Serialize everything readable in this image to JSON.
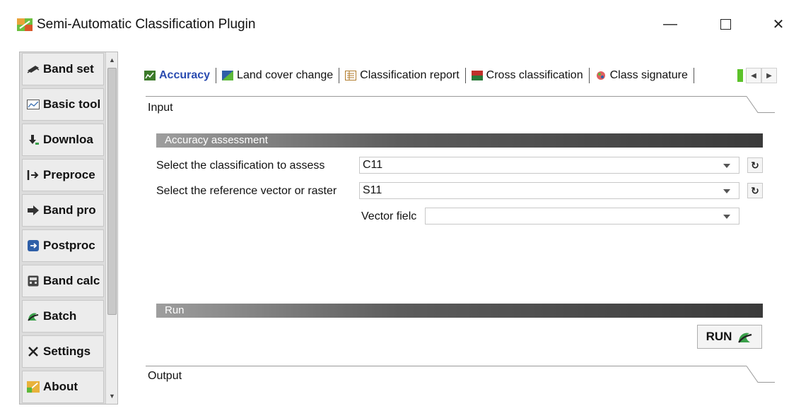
{
  "window": {
    "title": "Semi-Automatic Classification Plugin",
    "minimize_glyph": "—",
    "close_glyph": "✕"
  },
  "sidebar": {
    "items": [
      {
        "label": "Band set",
        "icon": "band-set-icon"
      },
      {
        "label": "Basic tool",
        "icon": "chart-icon"
      },
      {
        "label": "Downloa",
        "icon": "download-icon"
      },
      {
        "label": "Preproce",
        "icon": "preprocessing-icon"
      },
      {
        "label": "Band pro",
        "icon": "band-processing-icon"
      },
      {
        "label": "Postproc",
        "icon": "postprocessing-icon"
      },
      {
        "label": "Band calc",
        "icon": "calculator-icon"
      },
      {
        "label": "Batch",
        "icon": "batch-icon"
      },
      {
        "label": "Settings",
        "icon": "settings-icon"
      },
      {
        "label": "About",
        "icon": "about-icon"
      }
    ]
  },
  "tabs": [
    {
      "label": "Accuracy",
      "active": true
    },
    {
      "label": "Land cover change",
      "active": false
    },
    {
      "label": "Classification report",
      "active": false
    },
    {
      "label": "Cross classification",
      "active": false
    },
    {
      "label": "Class signature",
      "active": false
    }
  ],
  "groups": {
    "input_label": "Input",
    "output_label": "Output"
  },
  "accuracy_section": {
    "header": "Accuracy assessment",
    "classification_label": "Select the classification to assess",
    "classification_value": "C11",
    "reference_label": "Select the reference vector or raster",
    "reference_value": "S11",
    "vector_field_label": "Vector fielc",
    "vector_field_value": ""
  },
  "run_section": {
    "header": "Run",
    "run_button_label": "RUN"
  },
  "colors": {
    "accent_tab": "#2a4bb0",
    "section_bar_dark": "#3a3a3a"
  }
}
